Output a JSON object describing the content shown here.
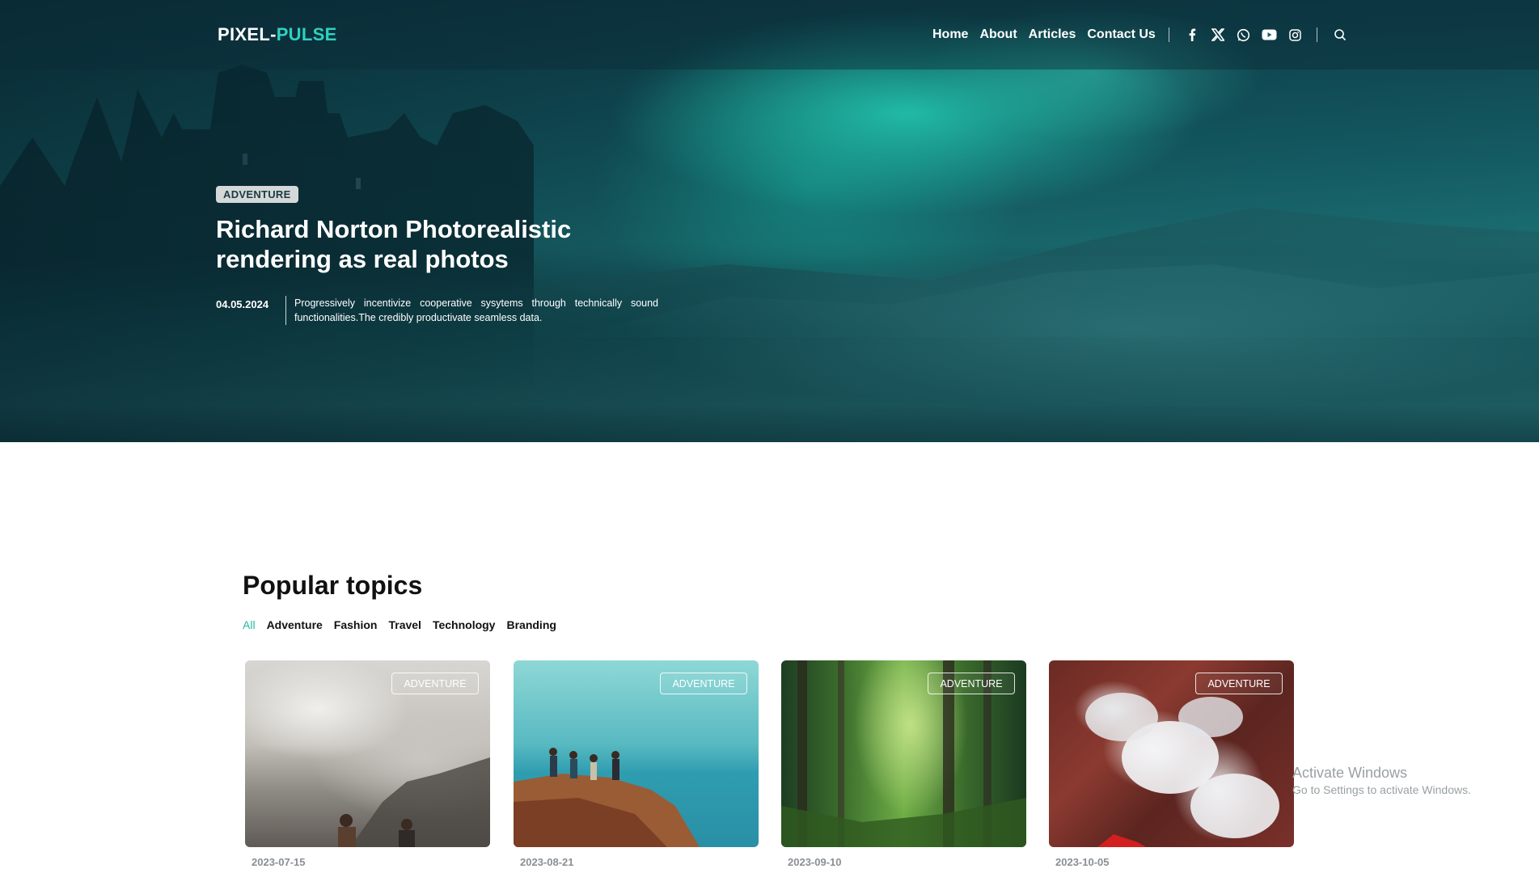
{
  "header": {
    "logo_part1": "PIXEL-",
    "logo_part2": "PULSE",
    "nav": [
      "Home",
      "About",
      "Articles",
      "Contact Us"
    ],
    "social_icons": [
      "facebook-icon",
      "x-icon",
      "whatsapp-icon",
      "youtube-icon",
      "instagram-icon"
    ],
    "search_icon": "search-icon"
  },
  "hero": {
    "badge": "ADVENTURE",
    "title_line1": "Richard Norton Photorealistic",
    "title_line2": "rendering as real photos",
    "date": "04.05.2024",
    "description": "Progressively incentivize cooperative sysytems through technically sound functionalities.The credibly productivate seamless data."
  },
  "popular": {
    "title": "Popular topics",
    "filters": [
      "All",
      "Adventure",
      "Fashion",
      "Travel",
      "Technology",
      "Branding"
    ],
    "active_filter": "All",
    "cards": [
      {
        "tag": "ADVENTURE",
        "date": "2023-07-15"
      },
      {
        "tag": "ADVENTURE",
        "date": "2023-08-21"
      },
      {
        "tag": "ADVENTURE",
        "date": "2023-09-10"
      },
      {
        "tag": "ADVENTURE",
        "date": "2023-10-05"
      }
    ]
  },
  "watermark": {
    "line1": "Activate Windows",
    "line2": "Go to Settings to activate Windows."
  },
  "colors": {
    "accent": "#2fd1c0",
    "active_filter": "#27b5a6"
  }
}
